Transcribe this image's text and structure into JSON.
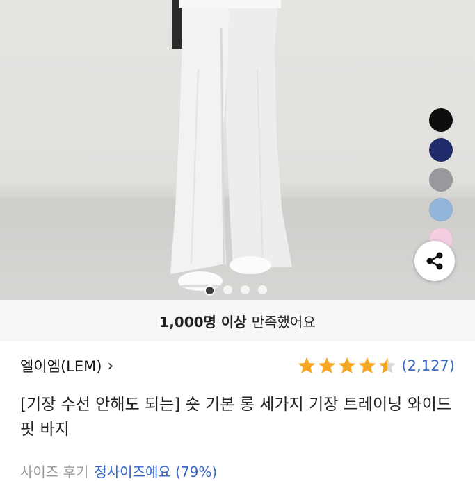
{
  "colors": {
    "accent_blue": "#3566c8",
    "star": "#f5a623"
  },
  "gallery": {
    "color_swatches": [
      {
        "name": "black",
        "color": "#0d0d0d"
      },
      {
        "name": "navy",
        "color": "#1f2b6b"
      },
      {
        "name": "gray",
        "color": "#97999c"
      },
      {
        "name": "sky-blue",
        "color": "#92b5da"
      },
      {
        "name": "pink",
        "color": "#f3cfe1"
      }
    ],
    "slide_count": 4,
    "active_slide": 1
  },
  "satisfaction": {
    "count_text": "1,000명 이상",
    "suffix_text": "만족했어요"
  },
  "brand": {
    "name": "엘이엠(LEM)",
    "chevron": "›"
  },
  "rating": {
    "score": 4.5,
    "review_count": "(2,127)"
  },
  "product": {
    "title": "[기장 수선 안해도 되는] 숏 기본 롱 세가지 기장 트레이닝 와이드 핏 바지"
  },
  "size_review": {
    "label": "사이즈 후기",
    "value": "정사이즈예요 (79%)"
  }
}
